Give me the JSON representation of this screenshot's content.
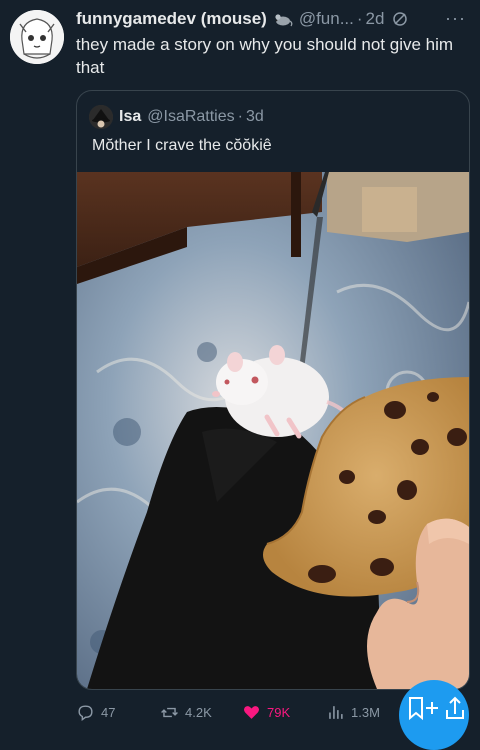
{
  "post": {
    "display_name": "funnygamedev (mouse)",
    "handle": "@fun...",
    "separator": "·",
    "time": "2d",
    "text": "they made a story on why you should not give him that",
    "more_icon": "ellipsis-icon",
    "badge_icon": "mouse-icon"
  },
  "quote": {
    "display_name": "Isa",
    "handle": "@IsaRatties",
    "separator": "·",
    "time": "3d",
    "text": "Mŏther I crave the cŏŏkiê"
  },
  "actions": {
    "replies": "47",
    "reposts": "4.2K",
    "likes": "79K",
    "views": "1.3M"
  },
  "colors": {
    "background": "#15202b",
    "like_active": "#f91880",
    "accent": "#1d9bf0",
    "muted": "#8b98a5"
  }
}
